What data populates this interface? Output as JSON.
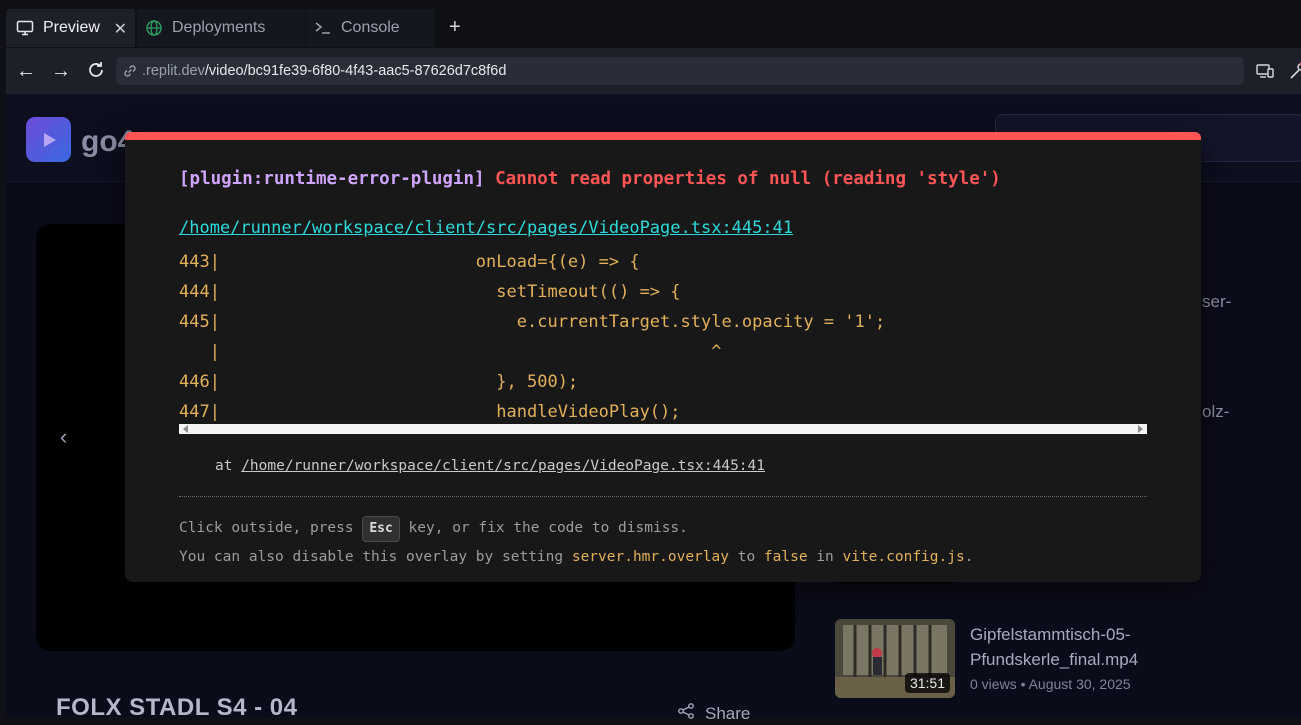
{
  "tabs": [
    {
      "label": "Preview",
      "icon": "monitor-icon",
      "active": true
    },
    {
      "label": "Deployments",
      "icon": "globe-icon",
      "active": false
    },
    {
      "label": "Console",
      "icon": "terminal-icon",
      "active": false
    }
  ],
  "address_bar": {
    "url_domain": ".replit.dev",
    "url_path": "/video/bc91fe39-6f80-4f43-aac5-87626d7c8f6d"
  },
  "app": {
    "logo_text": "go4",
    "video_title": "FOLX STADL S4 - 04",
    "share_label": "Share",
    "side_fragments": [
      "ser-",
      "olz-"
    ],
    "recommendation": {
      "title": "Gipfelstammtisch-05-Pfundskerle_final.mp4",
      "duration": "31:51",
      "meta": "0 views • August 30, 2025"
    }
  },
  "error_overlay": {
    "plugin": "[plugin:runtime-error-plugin]",
    "message": "Cannot read properties of null (reading 'style')",
    "file": "/home/runner/workspace/client/src/pages/VideoPage.tsx:445:41",
    "code_frame": "443|                         onLoad={(e) => {\n444|                           setTimeout(() => {\n445|                             e.currentTarget.style.opacity = '1';\n   |                                                ^\n446|                           }, 500);\n447|                           handleVideoPlay();",
    "stack_prefix": "at ",
    "stack_path": "/home/runner/workspace/client/src/pages/VideoPage.tsx:445:41",
    "tip_line1_before": "Click outside, press ",
    "tip_key": "Esc",
    "tip_line1_after": " key, or fix the code to dismiss.",
    "tip_line2_a": "You can also disable this overlay by setting ",
    "tip_line2_code1": "server.hmr.overlay",
    "tip_line2_b": " to ",
    "tip_line2_code2": "false",
    "tip_line2_c": " in ",
    "tip_line2_code3": "vite.config.js",
    "tip_line2_d": "."
  },
  "colors": {
    "error_red": "#ff5555",
    "plugin_purple": "#cfa4ff",
    "file_cyan": "#2dd9da",
    "code_yellow": "#e3b05a"
  }
}
